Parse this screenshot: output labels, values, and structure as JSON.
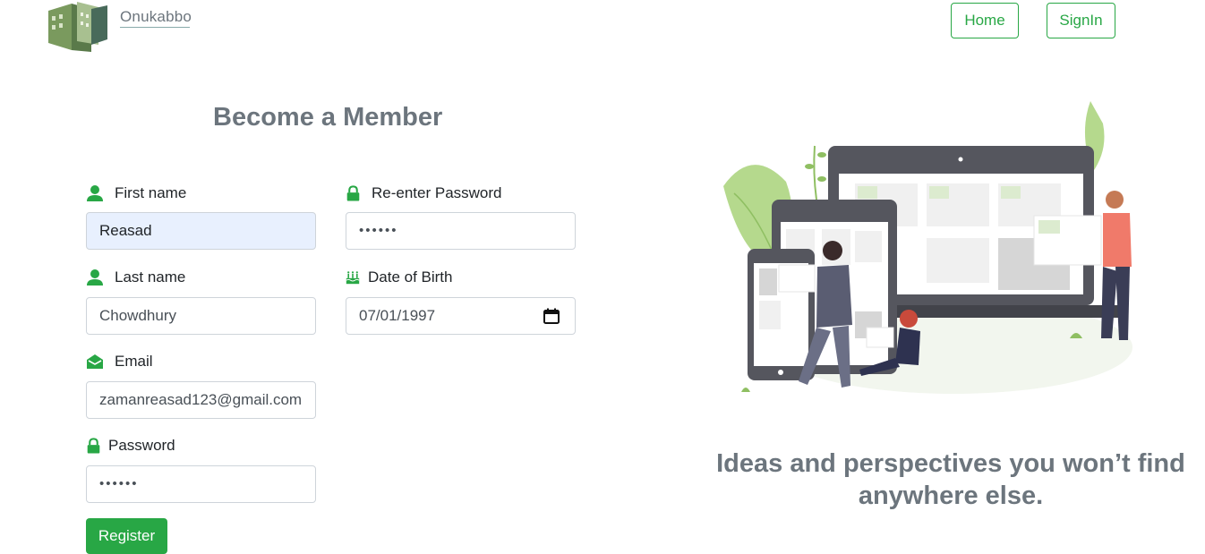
{
  "header": {
    "brand": "Onukabbo",
    "nav": {
      "home": "Home",
      "signin": "SignIn"
    }
  },
  "form": {
    "title": "Become a Member",
    "first_name": {
      "label": "First name",
      "value": "Reasad"
    },
    "last_name": {
      "label": "Last name",
      "value": "Chowdhury"
    },
    "email": {
      "label": "Email",
      "value": "zamanreasad123@gmail.com"
    },
    "password": {
      "label": "Password",
      "value": "••••••"
    },
    "reenter_password": {
      "label": "Re-enter Password",
      "value": "••••••"
    },
    "dob": {
      "label": "Date of Birth",
      "value": "07/01/1997"
    },
    "register": "Register"
  },
  "tagline": "Ideas and perspectives you won’t find anywhere else.",
  "colors": {
    "accent": "#28a745",
    "muted": "#6c757d",
    "autofill": "#e8f0fe"
  },
  "icons": [
    "user-icon",
    "lock-icon",
    "envelope-icon",
    "birthday-cake-icon",
    "calendar-icon"
  ]
}
